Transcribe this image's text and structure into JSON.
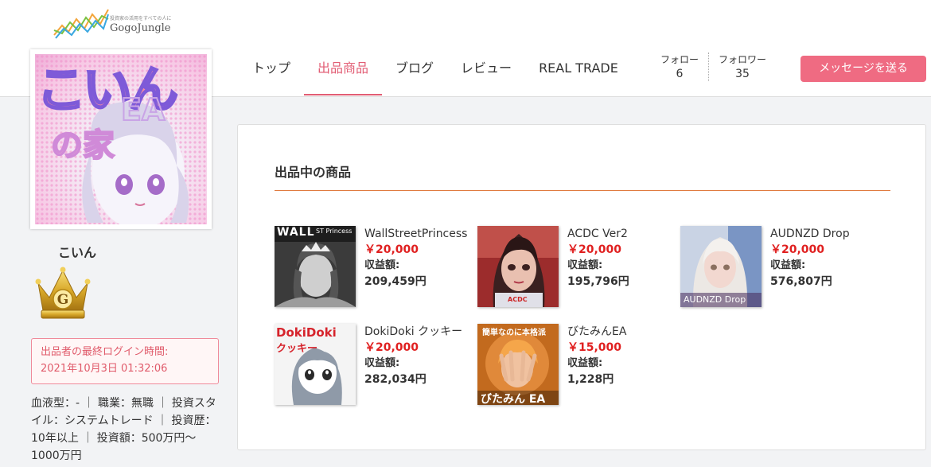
{
  "header": {
    "logo_tagline": "投資家の活用をすべての人に",
    "logo_brand": "GogoJungle",
    "nav": [
      {
        "label": "トップ"
      },
      {
        "label": "出品商品"
      },
      {
        "label": "ブログ"
      },
      {
        "label": "レビュー"
      },
      {
        "label": "REAL TRADE"
      }
    ],
    "follow_label": "フォロー",
    "follow_count": "6",
    "follower_label": "フォロワー",
    "follower_count": "35",
    "message_button": "メッセージを送る"
  },
  "profile": {
    "avatar_text_top": "こいん",
    "avatar_text_ea": "EA",
    "avatar_text_bottom": "の家",
    "username": "こいん",
    "rank_letter": "G",
    "login_label": "出品者の最終ログイン時間:",
    "login_time": "2021年10月3日 01:32:06",
    "details": "血液型：- ｜ 職業：無職 ｜ 投資スタイル：システムトレード ｜ 投資歴：10年以上 ｜ 投資額：500万円〜1000万円"
  },
  "main": {
    "section_title": "出品中の商品",
    "earnings_label": "収益額:",
    "products": [
      {
        "name": "WallStreetPrincess",
        "price": "￥20,000",
        "earnings": "209,459円",
        "thumb_text": "WALL",
        "thumb_sub": "ST Princess"
      },
      {
        "name": "ACDC Ver2",
        "price": "￥20,000",
        "earnings": "195,796円",
        "thumb_text": "ACDC"
      },
      {
        "name": "AUDNZD Drop",
        "price": "￥20,000",
        "earnings": "576,807円",
        "thumb_text": "AUDNZD Drop"
      },
      {
        "name": "DokiDoki クッキー",
        "price": "￥20,000",
        "earnings": "282,034円",
        "thumb_text": "DokiDoki",
        "thumb_sub": "クッキー"
      },
      {
        "name": "びたみんEA",
        "price": "￥15,000",
        "earnings": "1,228円",
        "thumb_text": "びたみん EA",
        "thumb_sub": "簡単なのに本格派"
      }
    ]
  }
}
